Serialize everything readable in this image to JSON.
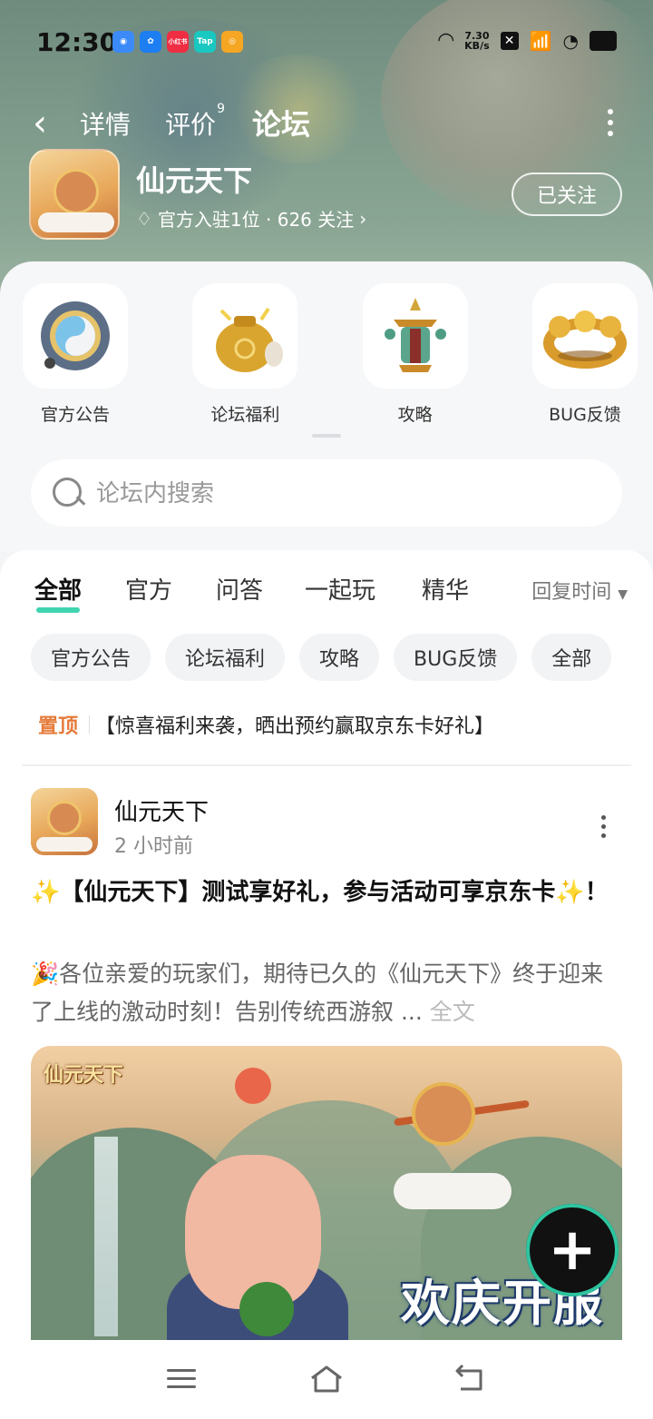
{
  "status": {
    "time": "12:30",
    "net_speed_value": "7.30",
    "net_speed_unit": "KB/s",
    "apps": [
      {
        "name": "browser-icon",
        "color": "#3b8af7",
        "label": ""
      },
      {
        "name": "fish-icon",
        "color": "#1d7ef2",
        "label": ""
      },
      {
        "name": "xiaohongshu-icon",
        "color": "#ef2d43",
        "label": "小红书"
      },
      {
        "name": "taptap-icon",
        "color": "#19c8c0",
        "label": "Tap"
      },
      {
        "name": "weibo-icon",
        "color": "#f5a623",
        "label": ""
      }
    ]
  },
  "nav": {
    "tabs": [
      "详情",
      "评价",
      "论坛"
    ],
    "review_badge": "9",
    "active_tab": "论坛"
  },
  "app": {
    "name": "仙元天下",
    "subtitle": "官方入驻1位 · 626 关注",
    "follow_label": "已关注"
  },
  "categories": [
    {
      "label": "官方公告",
      "icon": "compass-icon"
    },
    {
      "label": "论坛福利",
      "icon": "gold-bag-icon"
    },
    {
      "label": "攻略",
      "icon": "lantern-icon"
    },
    {
      "label": "BUG反馈",
      "icon": "golden-ring-icon"
    }
  ],
  "search": {
    "placeholder": "论坛内搜索"
  },
  "feed_tabs": [
    "全部",
    "官方",
    "问答",
    "一起玩",
    "精华"
  ],
  "sort_label": "回复时间",
  "chips": [
    "官方公告",
    "论坛福利",
    "攻略",
    "BUG反馈",
    "全部"
  ],
  "pinned": {
    "tag": "置顶",
    "text": "【惊喜福利来袭，晒出预约赢取京东卡好礼】"
  },
  "post": {
    "author": "仙元天下",
    "time": "2 小时前",
    "title": "✨【仙元天下】测试享好礼，参与活动可享京东卡✨！",
    "body": "🎉各位亲爱的玩家们，期待已久的《仙元天下》终于迎来了上线的激动时刻！告别传统西游叙 ...",
    "read_more": "全文",
    "image_logo": "仙元天下",
    "image_slogan": "欢庆开服"
  },
  "colors": {
    "accent": "#40d4b0",
    "pinned": "#e57b3a"
  }
}
